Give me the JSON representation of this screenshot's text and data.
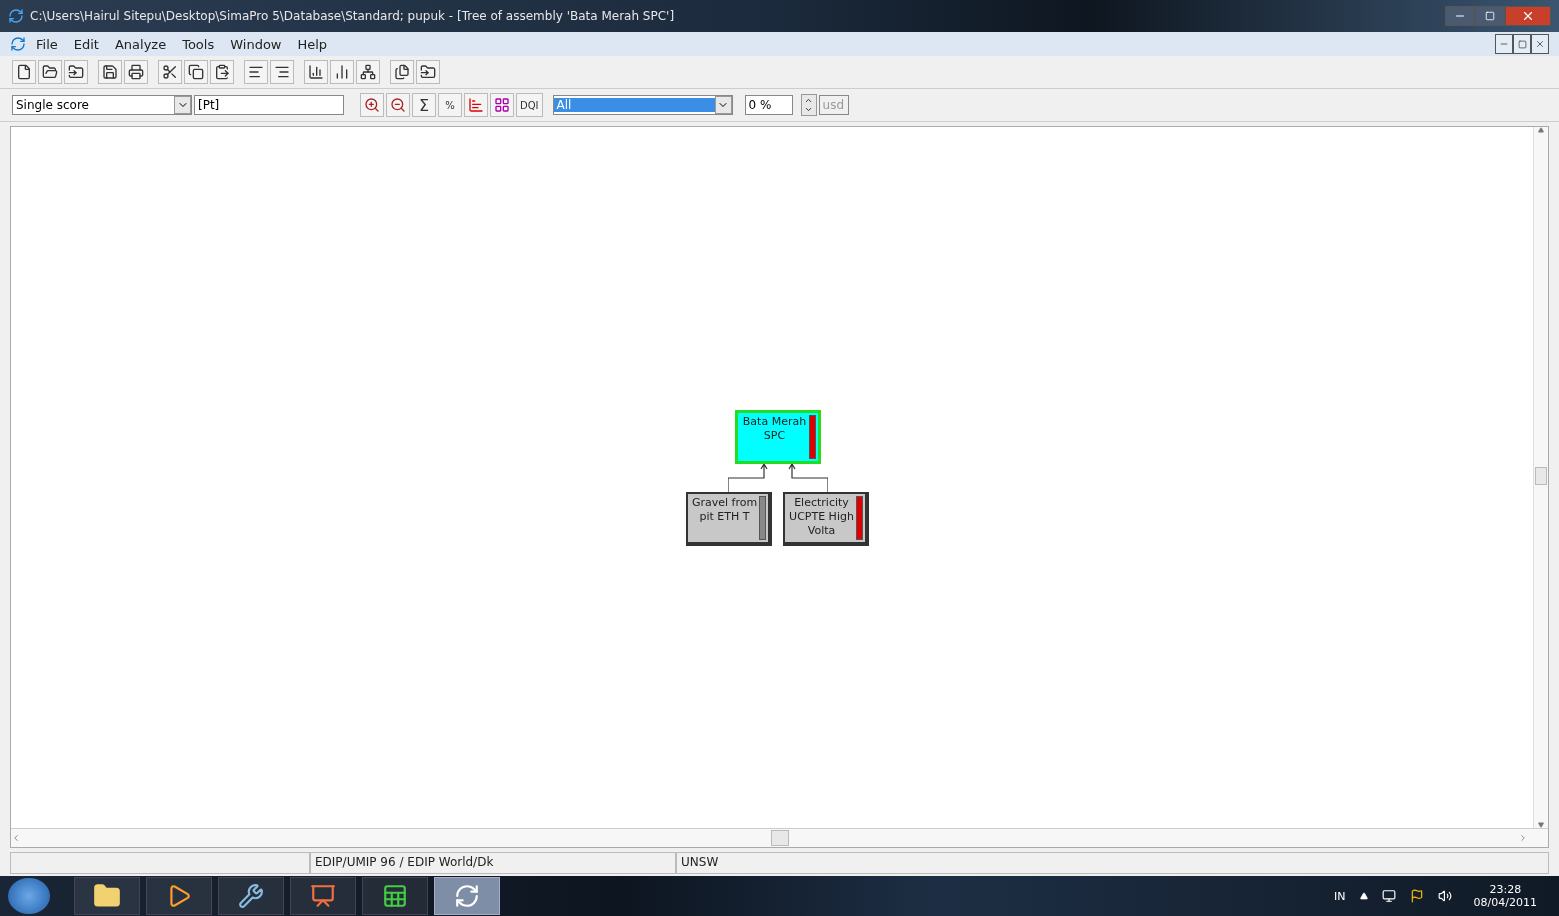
{
  "window": {
    "title": "C:\\Users\\Hairul Sitepu\\Desktop\\SimaPro 5\\Database\\Standard; pupuk - [Tree of assembly 'Bata Merah SPC']"
  },
  "menu": [
    "File",
    "Edit",
    "Analyze",
    "Tools",
    "Window",
    "Help"
  ],
  "toolbar2": {
    "indicator": "Single score",
    "unit": "[Pt]",
    "sum": "Σ",
    "percent": "%",
    "dqi": "DQI",
    "filter": "All",
    "cutoff": "0 %",
    "currency": "usd"
  },
  "tree": {
    "root": {
      "label": "Bata Merah SPC",
      "level": 1
    },
    "children": [
      {
        "label": "Gravel from pit ETH T",
        "level": 0
      },
      {
        "label": "Electricity UCPTE High Volta",
        "level": 1
      }
    ]
  },
  "status_bar": {
    "method": "EDIP/UMIP 96 /  EDIP World/Dk",
    "user": "UNSW"
  },
  "taskbar": {
    "apps": [
      {
        "kind": "explorer",
        "selected": false
      },
      {
        "kind": "media",
        "selected": false
      },
      {
        "kind": "tools",
        "selected": false
      },
      {
        "kind": "slides",
        "selected": false
      },
      {
        "kind": "sheet",
        "selected": false
      },
      {
        "kind": "simapro",
        "selected": true
      }
    ],
    "language": "IN",
    "time": "23:28",
    "date": "08/04/2011"
  }
}
